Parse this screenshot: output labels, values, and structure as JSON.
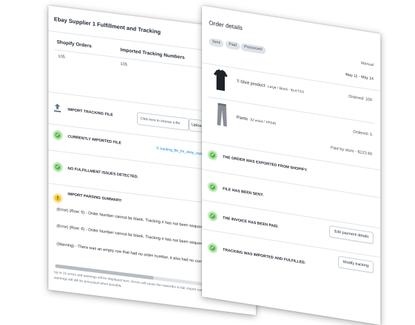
{
  "left": {
    "title": "Ebay Supplier 1 Fulfillment and Tracking",
    "table": {
      "headers": [
        "Shopify Orders",
        "Imported Tracking Numbers"
      ],
      "values": [
        "105",
        "105"
      ]
    },
    "import": {
      "label": "IMPORT TRACKING FILE",
      "file_placeholder": "Click here to choose a file",
      "upload_label": "Uploa"
    },
    "current": {
      "label": "CURRENTLY IMPORTED FILE",
      "file_link": "tracking_file_for_ebay_supp"
    },
    "no_issues": {
      "label": "NO FULFILLMENT ISSUES DETECTED."
    },
    "summary": {
      "label": "IMPORT PARSING SUMMARY:",
      "messages": [
        "(Error) (Row: 5) - Order Number cannot be blank. Tracking # has not been sequentially",
        "(Error) (Row: 6) - Order Number cannot be blank. Tracking # has not been sequentially",
        "(Warning) - There was an empty row that had no order number, it also had no correspo"
      ]
    },
    "footer": [
      "Up to 15 errors and warnings will be displayed here. Errors will cause the row/order to fail, import correct",
      "warnings will still be processed when possible."
    ]
  },
  "right": {
    "title": "Order details",
    "chips": [
      "Sent",
      "Paid",
      "Processed"
    ],
    "mode": "Manual",
    "date_range": "May 11 - May 14",
    "items": [
      {
        "name": "T-Shirt product",
        "variant": "Large / Black - BLKTSS",
        "ordered": "Ordered: 100"
      },
      {
        "name": "Pants",
        "variant": "32 waist / XP345",
        "ordered": "Ordered: 5"
      }
    ],
    "paid_by": "Paid by store - $123.90",
    "statuses": [
      {
        "label": "THE ORDER WAS EXPORTED FROM SHOPIFY."
      },
      {
        "label": "FILE HAS BEEN SENT."
      },
      {
        "label": "THE INVOICE HAS BEEN PAID.",
        "button": "Edit payment details"
      },
      {
        "label": "TRACKING WAS IMPORTED AND FULFILLED.",
        "button": "Modify tracking"
      }
    ]
  },
  "colors": {
    "success": "#50b83c",
    "warning": "#eec200",
    "link": "#007ace",
    "text": "#212b36"
  }
}
